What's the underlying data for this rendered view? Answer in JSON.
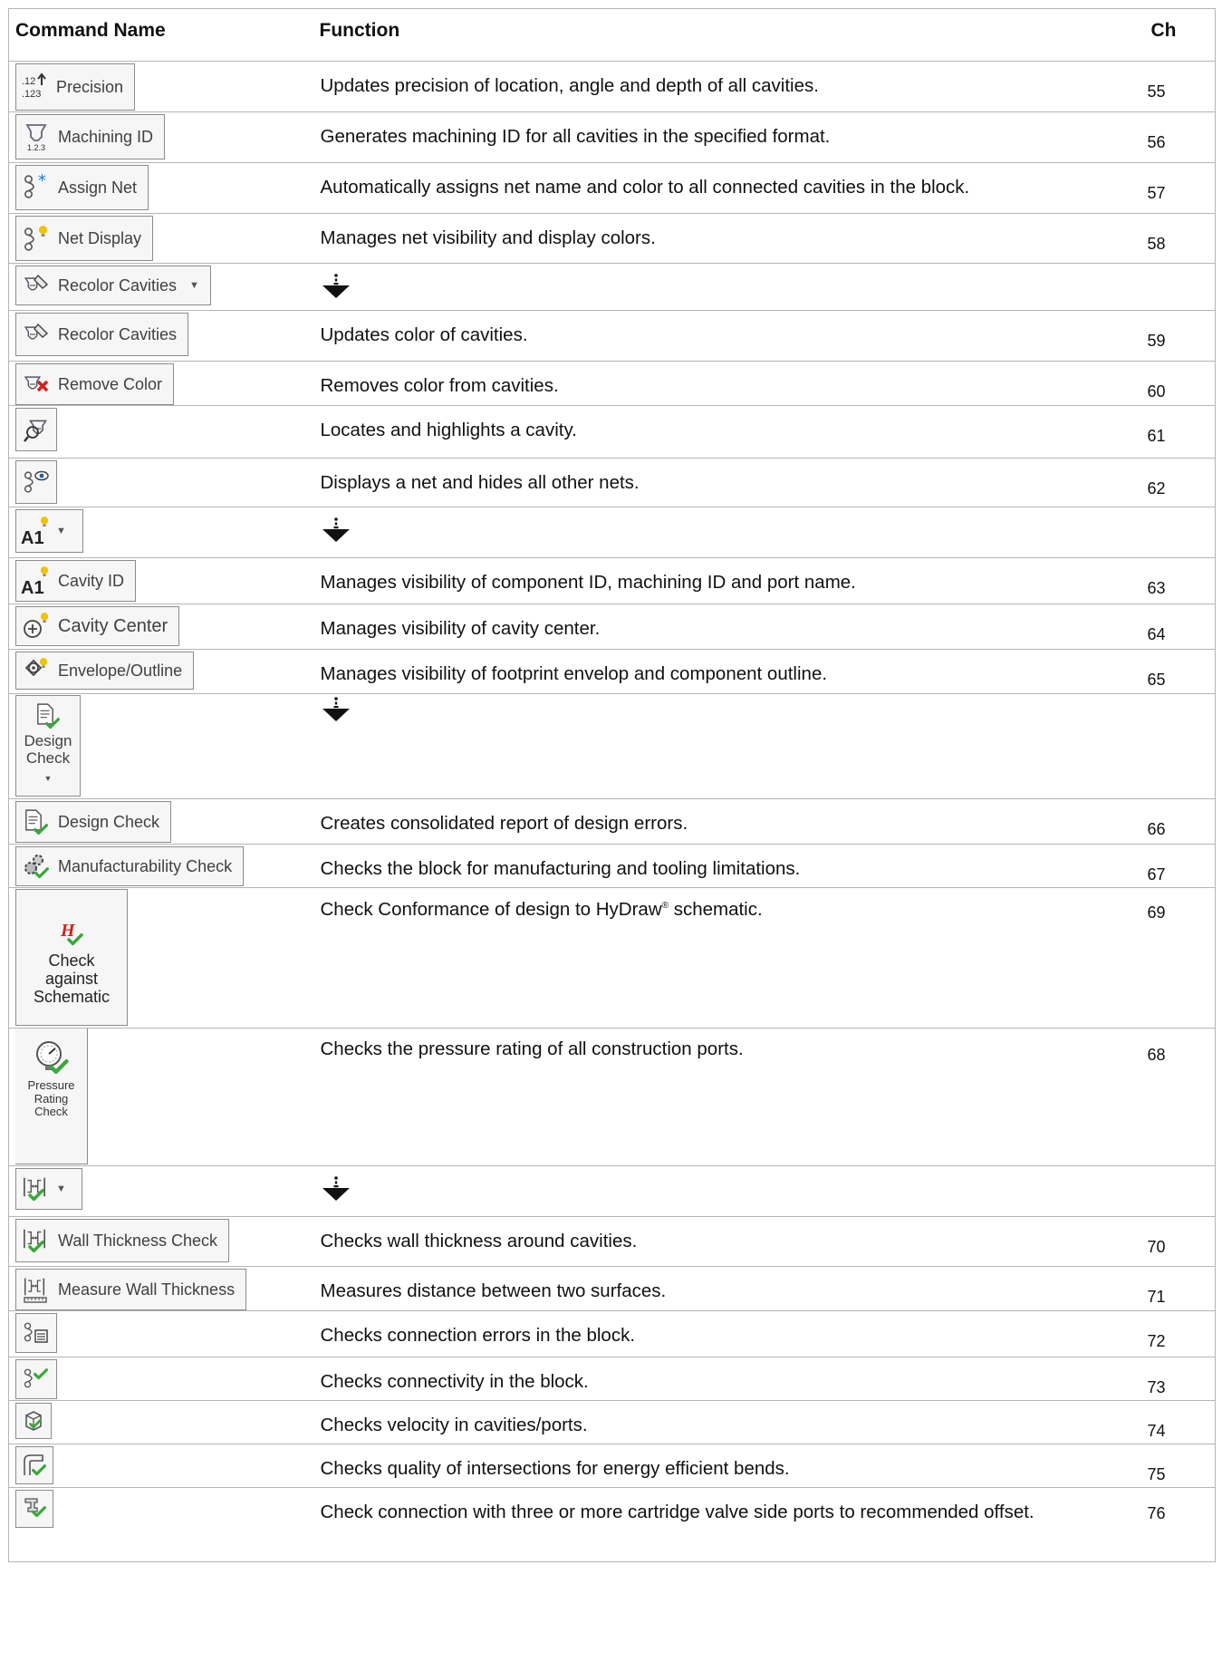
{
  "header": {
    "command": "Command Name",
    "function": "Function",
    "ch": "Ch"
  },
  "rows": [
    {
      "label": "Precision",
      "icon": "precision-icon",
      "fn": "Updates precision of location, angle and depth of all cavities.",
      "ch": "55"
    },
    {
      "label": "Machining ID",
      "icon": "machining-id-icon",
      "fn": "Generates machining ID for all cavities in the specified format.",
      "ch": "56"
    },
    {
      "label": "Assign Net",
      "icon": "assign-net-icon",
      "fn": "Automatically assigns net name and color to all connected cavities in the block.",
      "ch": "57"
    },
    {
      "label": "Net Display",
      "icon": "net-display-icon",
      "fn": "Manages net visibility and display colors.",
      "ch": "58"
    },
    {
      "label": "Recolor Cavities",
      "icon": "recolor-cavities-icon",
      "fn": "",
      "ch": ""
    },
    {
      "label": "Recolor Cavities",
      "icon": "recolor-cavities-icon",
      "fn": "Updates color of cavities.",
      "ch": "59"
    },
    {
      "label": "Remove Color",
      "icon": "remove-color-icon",
      "fn": "Removes color from cavities.",
      "ch": "60"
    },
    {
      "label": "",
      "icon": "locate-cavity-icon",
      "fn": "Locates and highlights a cavity.",
      "ch": "61"
    },
    {
      "label": "",
      "icon": "show-net-icon",
      "fn": "Displays a net and hides all other nets.",
      "ch": "62"
    },
    {
      "label": "",
      "icon": "cavity-id-dropdown-icon",
      "fn": "",
      "ch": ""
    },
    {
      "label": "Cavity ID",
      "icon": "cavity-id-icon",
      "fn": "Manages visibility of component ID, machining ID and port name.",
      "ch": "63"
    },
    {
      "label": "Cavity Center",
      "icon": "cavity-center-icon",
      "fn": "Manages visibility of cavity center.",
      "ch": "64"
    },
    {
      "label": "Envelope/Outline",
      "icon": "envelope-outline-icon",
      "fn": "Manages visibility of footprint envelop and component outline.",
      "ch": "65"
    },
    {
      "label_line1": "Design",
      "label_line2": "Check",
      "icon": "design-check-dropdown-icon",
      "fn": "",
      "ch": ""
    },
    {
      "label": "Design Check",
      "icon": "design-check-icon",
      "fn": "Creates consolidated report of design errors.",
      "ch": "66"
    },
    {
      "label": "Manufacturability Check",
      "icon": "manufacturability-check-icon",
      "fn": "Checks the block for manufacturing and tooling limitations.",
      "ch": "67"
    },
    {
      "label_line1": "Check",
      "label_line2": "against",
      "label_line3": "Schematic",
      "icon": "check-against-schematic-icon",
      "fn_pre": "Check Conformance of design to HyDraw",
      "fn_reg": "®",
      "fn_post": " schematic.",
      "ch": "69"
    },
    {
      "label_line1": "Pressure",
      "label_line2": "Rating",
      "label_line3": "Check",
      "icon": "pressure-rating-check-icon",
      "fn": "Checks the pressure rating of all construction ports.",
      "ch": "68"
    },
    {
      "label": "",
      "icon": "wall-thickness-dropdown-icon",
      "fn": "",
      "ch": ""
    },
    {
      "label": "Wall Thickness Check",
      "icon": "wall-thickness-check-icon",
      "fn": "Checks wall thickness around cavities.",
      "ch": "70"
    },
    {
      "label": "Measure Wall Thickness",
      "icon": "measure-wall-thickness-icon",
      "fn": "Measures distance between two surfaces.",
      "ch": "71"
    },
    {
      "label": "",
      "icon": "connection-errors-icon",
      "fn": "Checks connection errors in the block.",
      "ch": "72"
    },
    {
      "label": "",
      "icon": "connectivity-check-icon",
      "fn": "Checks connectivity in the block.",
      "ch": "73"
    },
    {
      "label": "",
      "icon": "velocity-check-icon",
      "fn": "Checks velocity in cavities/ports.",
      "ch": "74"
    },
    {
      "label": "",
      "icon": "intersection-quality-icon",
      "fn": "Checks quality of intersections for energy efficient bends.",
      "ch": "75"
    },
    {
      "label": "",
      "icon": "cartridge-offset-icon",
      "fn": "Check connection with three or more cartridge valve side ports to recommended offset.",
      "ch": "76"
    }
  ],
  "colors": {
    "check_green": "#3aa83a",
    "bulb_yellow": "#f2c200",
    "red_x": "#d32020",
    "hydraw_red": "#d81c1c"
  }
}
